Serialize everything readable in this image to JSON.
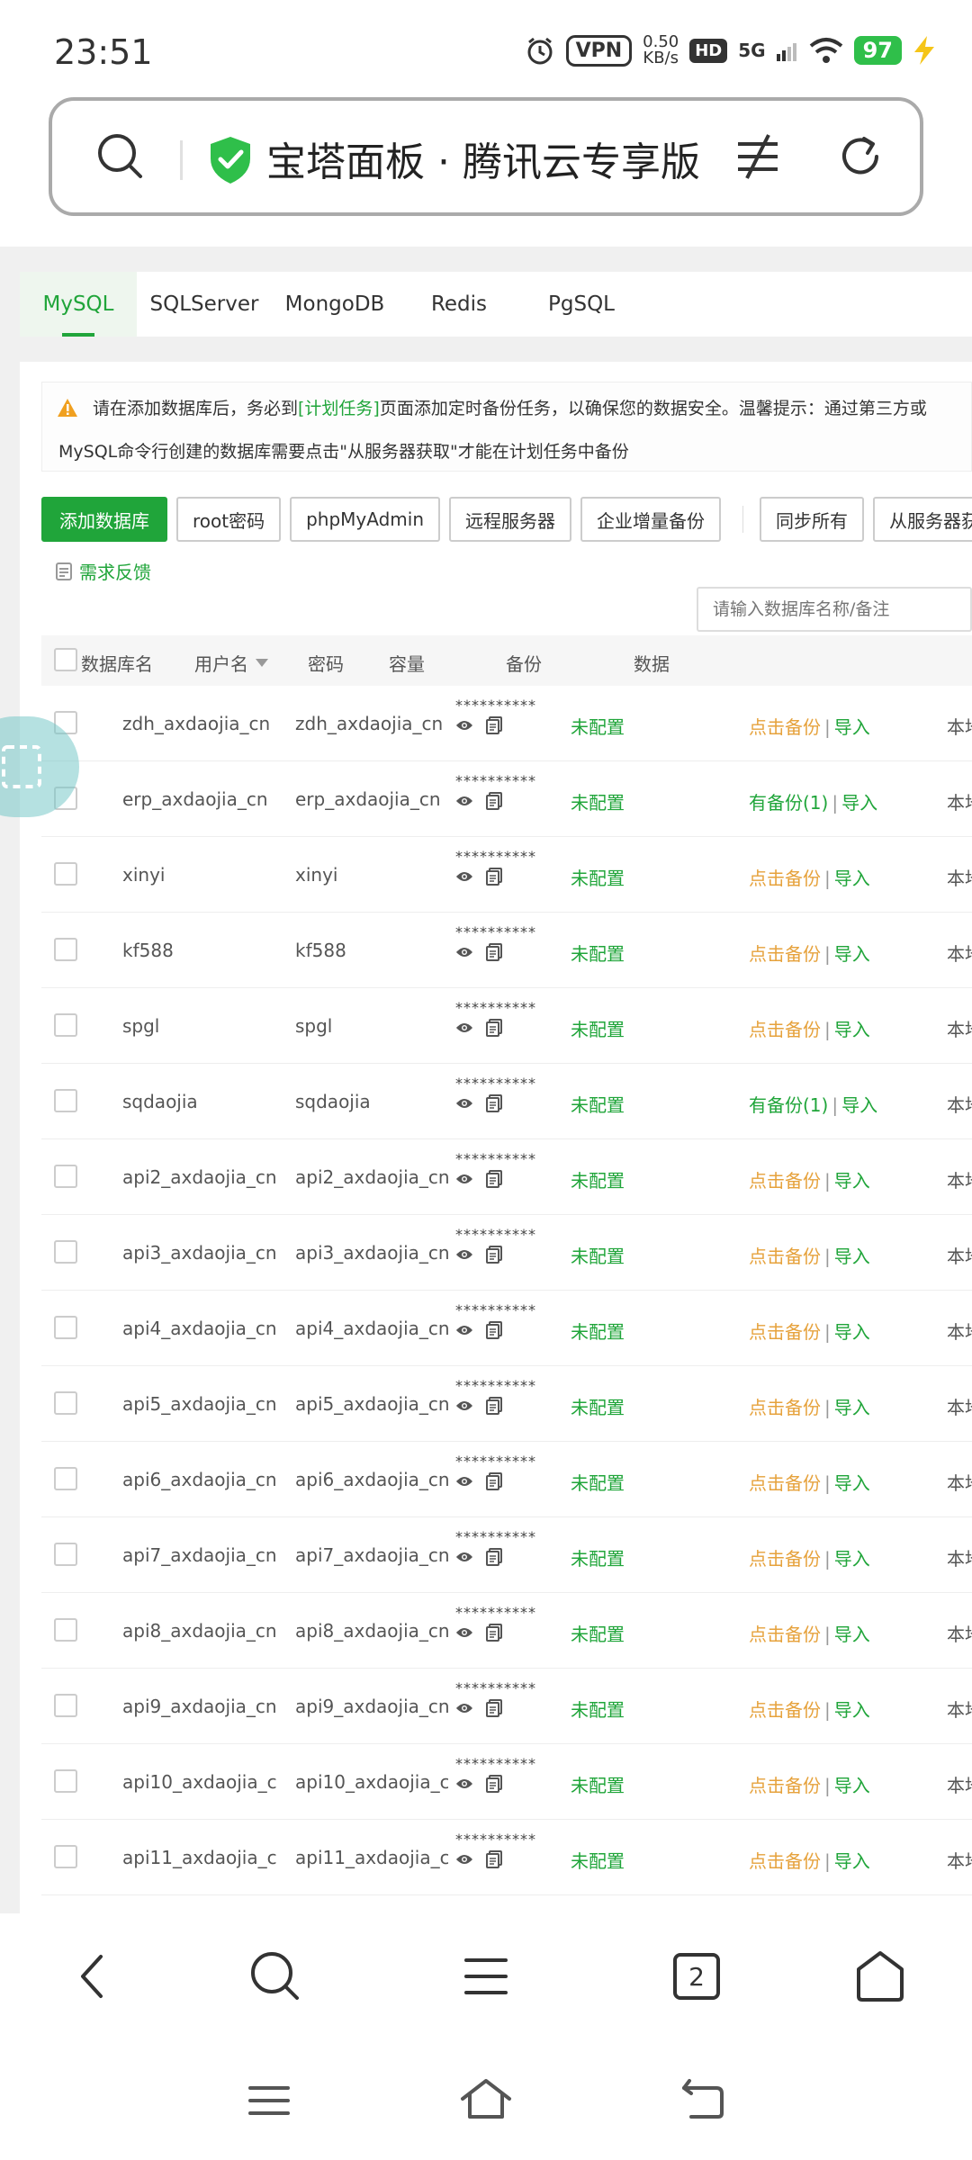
{
  "status_bar": {
    "time": "23:51",
    "vpn_label": "VPN",
    "speed_value": "0.50",
    "speed_unit": "KB/s",
    "hd_label": "HD",
    "network_label": "5G",
    "battery_level": "97"
  },
  "browser": {
    "page_title": "宝塔面板 · 腾讯云专享版"
  },
  "tabs": [
    {
      "label": "MySQL",
      "active": true
    },
    {
      "label": "SQLServer"
    },
    {
      "label": "MongoDB"
    },
    {
      "label": "Redis"
    },
    {
      "label": "PgSQL"
    }
  ],
  "notice": {
    "line1_prefix": "请在添加数据库后，务必到",
    "line1_link": "[计划任务]",
    "line1_suffix": "页面添加定时备份任务，以确保您的数据安全。温馨提示：通过第三方或",
    "line2": "MySQL命令行创建的数据库需要点击\"从服务器获取\"才能在计划任务中备份"
  },
  "toolbar": {
    "add_db": "添加数据库",
    "root_pw": "root密码",
    "phpmyadmin": "phpMyAdmin",
    "remote": "远程服务器",
    "incremental": "企业增量备份",
    "sync_all": "同步所有",
    "from_server": "从服务器获"
  },
  "feedback": "需求反馈",
  "search": {
    "placeholder": "请输入数据库名称/备注"
  },
  "table": {
    "headers": {
      "name": "数据库名",
      "user": "用户名",
      "password": "密码",
      "capacity": "容量",
      "backup": "备份",
      "location": "数据"
    },
    "rows": [
      {
        "name": "zdh_axdaojia_cn",
        "user": "zdh_axdaojia_cn",
        "password": "**********",
        "capacity": "未配置",
        "backup": "点击备份",
        "has_backup": false,
        "import": "导入",
        "location": "本地"
      },
      {
        "name": "erp_axdaojia_cn",
        "user": "erp_axdaojia_cn",
        "password": "**********",
        "capacity": "未配置",
        "backup": "有备份(1)",
        "has_backup": true,
        "import": "导入",
        "location": "本地"
      },
      {
        "name": "xinyi",
        "user": "xinyi",
        "password": "**********",
        "capacity": "未配置",
        "backup": "点击备份",
        "has_backup": false,
        "import": "导入",
        "location": "本地"
      },
      {
        "name": "kf588",
        "user": "kf588",
        "password": "**********",
        "capacity": "未配置",
        "backup": "点击备份",
        "has_backup": false,
        "import": "导入",
        "location": "本地"
      },
      {
        "name": "spgl",
        "user": "spgl",
        "password": "**********",
        "capacity": "未配置",
        "backup": "点击备份",
        "has_backup": false,
        "import": "导入",
        "location": "本地"
      },
      {
        "name": "sqdaojia",
        "user": "sqdaojia",
        "password": "**********",
        "capacity": "未配置",
        "backup": "有备份(1)",
        "has_backup": true,
        "import": "导入",
        "location": "本地"
      },
      {
        "name": "api2_axdaojia_cn",
        "user": "api2_axdaojia_cn",
        "password": "**********",
        "capacity": "未配置",
        "backup": "点击备份",
        "has_backup": false,
        "import": "导入",
        "location": "本地"
      },
      {
        "name": "api3_axdaojia_cn",
        "user": "api3_axdaojia_cn",
        "password": "**********",
        "capacity": "未配置",
        "backup": "点击备份",
        "has_backup": false,
        "import": "导入",
        "location": "本地"
      },
      {
        "name": "api4_axdaojia_cn",
        "user": "api4_axdaojia_cn",
        "password": "**********",
        "capacity": "未配置",
        "backup": "点击备份",
        "has_backup": false,
        "import": "导入",
        "location": "本地"
      },
      {
        "name": "api5_axdaojia_cn",
        "user": "api5_axdaojia_cn",
        "password": "**********",
        "capacity": "未配置",
        "backup": "点击备份",
        "has_backup": false,
        "import": "导入",
        "location": "本地"
      },
      {
        "name": "api6_axdaojia_cn",
        "user": "api6_axdaojia_cn",
        "password": "**********",
        "capacity": "未配置",
        "backup": "点击备份",
        "has_backup": false,
        "import": "导入",
        "location": "本地"
      },
      {
        "name": "api7_axdaojia_cn",
        "user": "api7_axdaojia_cn",
        "password": "**********",
        "capacity": "未配置",
        "backup": "点击备份",
        "has_backup": false,
        "import": "导入",
        "location": "本地"
      },
      {
        "name": "api8_axdaojia_cn",
        "user": "api8_axdaojia_cn",
        "password": "**********",
        "capacity": "未配置",
        "backup": "点击备份",
        "has_backup": false,
        "import": "导入",
        "location": "本地"
      },
      {
        "name": "api9_axdaojia_cn",
        "user": "api9_axdaojia_cn",
        "password": "**********",
        "capacity": "未配置",
        "backup": "点击备份",
        "has_backup": false,
        "import": "导入",
        "location": "本地"
      },
      {
        "name": "api10_axdaojia_c",
        "user": "api10_axdaojia_c",
        "password": "**********",
        "capacity": "未配置",
        "backup": "点击备份",
        "has_backup": false,
        "import": "导入",
        "location": "本地"
      },
      {
        "name": "api11_axdaojia_c",
        "user": "api11_axdaojia_c",
        "password": "**********",
        "capacity": "未配置",
        "backup": "点击备份",
        "has_backup": false,
        "import": "导入",
        "location": "本地"
      }
    ]
  },
  "bottom_nav": {
    "tab_count": "2"
  },
  "colors": {
    "brand_green": "#20a53a",
    "backup_orange": "#e6a23c"
  }
}
